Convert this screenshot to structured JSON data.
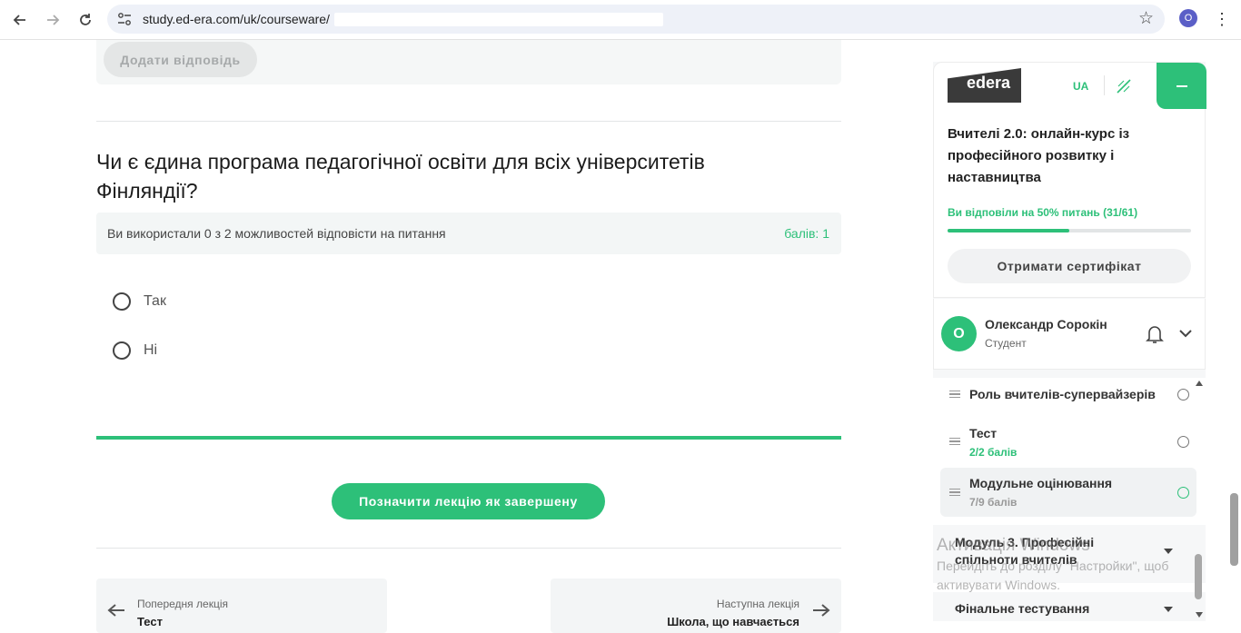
{
  "browser": {
    "url": "study.ed-era.com/uk/courseware/",
    "profile_initial": "O"
  },
  "main": {
    "add_answer_label": "Додати відповідь",
    "question_title": "Чи є єдина програма педагогічної освіти для всіх університетів Фінляндії?",
    "attempts_text": "Ви використали 0 з 2 можливостей відповісти на питання",
    "points_text": "балів: 1",
    "options": [
      "Так",
      "Ні"
    ],
    "complete_button": "Позначити лекцію як завершену",
    "prev_lecture": {
      "label": "Попередня лекція",
      "title": "Тест"
    },
    "next_lecture": {
      "label": "Наступна лекція",
      "title": "Школа, що навчається"
    }
  },
  "sidebar": {
    "logo_text": "edera",
    "lang": "UA",
    "course_title": "Вчителі 2.0: онлайн-курс із професійного розвитку і наставництва",
    "progress_label": "Ви відповіли на 50% питань (31/61)",
    "progress_fraction": 0.5,
    "certificate_button": "Отримати сертифікат",
    "user": {
      "initial": "О",
      "name": "Олександр Сорокін",
      "role": "Студент"
    },
    "lessons": [
      {
        "title": "Роль вчителів-супервайзерів",
        "sub": ""
      },
      {
        "title": "Тест",
        "sub": "2/2 балів"
      },
      {
        "title": "Модульне оцінювання",
        "sub": "7/9 балів"
      }
    ],
    "modules": [
      "Модуль 3. Професійні спільноти вчителів",
      "Фінальне тестування"
    ]
  },
  "watermark": {
    "line1": "Активація Windows",
    "line2": "Перейдіть до розділу \"Настройки\", щоб",
    "line3": "активувати Windows."
  },
  "colors": {
    "accent": "#2dc079",
    "sidebar_bg": "#f6f7f8"
  }
}
